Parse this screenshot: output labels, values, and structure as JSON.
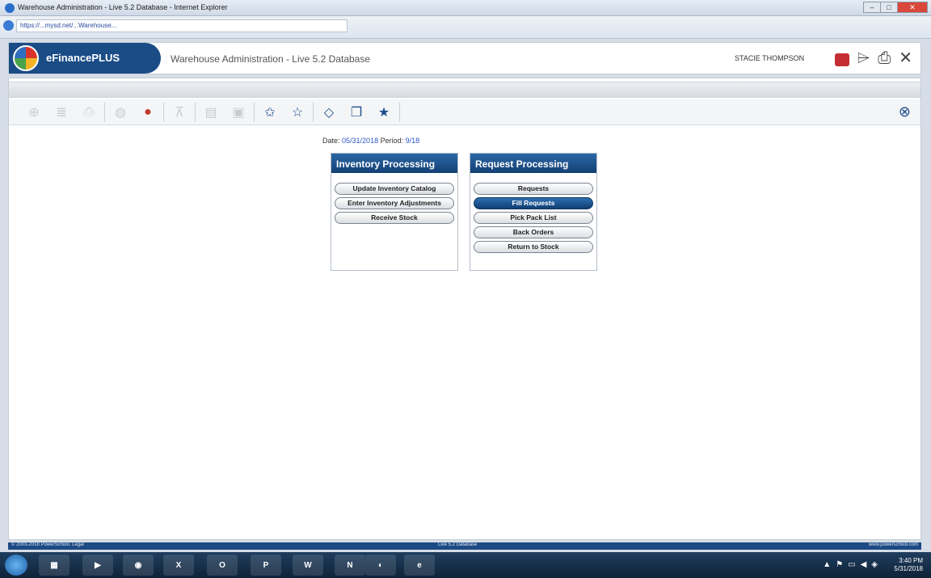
{
  "window": {
    "title": "Warehouse Administration - Live 5.2 Database - Internet Explorer",
    "url": "https://...mysd.net/...Warehouse..."
  },
  "app": {
    "brand": "eFinancePLUS",
    "title": "Warehouse Administration - Live 5.2 Database",
    "user": "STACIE THOMPSON"
  },
  "period": {
    "date_label": "Date:",
    "date_value": "05/31/2018",
    "period_label": "Period:",
    "period_value": "9/18"
  },
  "inventory_panel": {
    "title": "Inventory Processing",
    "buttons": [
      "Update Inventory Catalog",
      "Enter Inventory Adjustments",
      "Receive Stock"
    ]
  },
  "request_panel": {
    "title": "Request Processing",
    "buttons": [
      "Requests",
      "Fill Requests",
      "Pick Pack List",
      "Back Orders",
      "Return to Stock"
    ],
    "selected": "Fill Requests"
  },
  "statusbar": {
    "left": "© 2003-2018 PowerSchool. Legal",
    "center": "Live 5.2 Database",
    "right": "www.powerschool.com"
  },
  "taskbar": {
    "time": "3:40 PM",
    "date": "5/31/2018",
    "apps": [
      "explorer",
      "media",
      "chrome",
      "excel",
      "outlook",
      "powerpoint",
      "word",
      "onenote",
      "app",
      "ie"
    ]
  }
}
